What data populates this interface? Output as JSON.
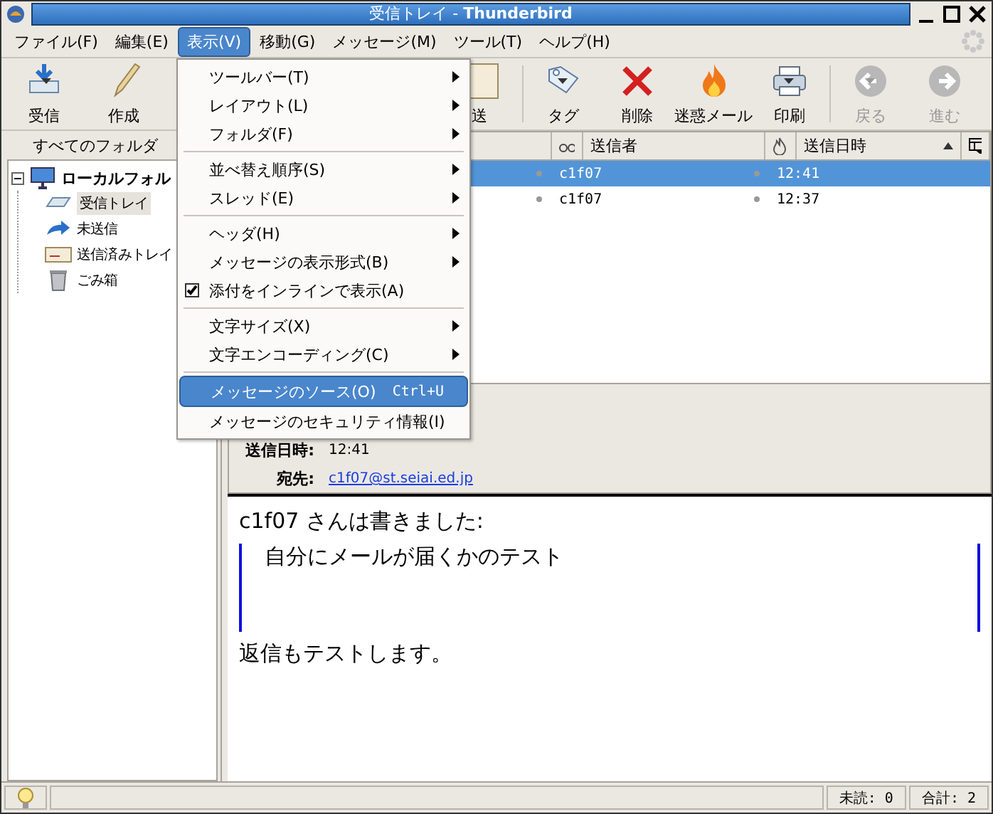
{
  "window": {
    "title": "受信トレイ - ",
    "title_bold": "Thunderbird"
  },
  "menubar": [
    {
      "label": "ファイル(F)",
      "selected": false
    },
    {
      "label": "編集(E)",
      "selected": false
    },
    {
      "label": "表示(V)",
      "selected": true
    },
    {
      "label": "移動(G)",
      "selected": false
    },
    {
      "label": "メッセージ(M)",
      "selected": false
    },
    {
      "label": "ツール(T)",
      "selected": false
    },
    {
      "label": "ヘルプ(H)",
      "selected": false
    }
  ],
  "toolbar": [
    {
      "label": "受信",
      "dropdown": true,
      "disabled": false
    },
    {
      "label": "作成",
      "dropdown": false,
      "disabled": false
    },
    {
      "label": "送",
      "dropdown": false,
      "disabled": false
    },
    {
      "label": "タグ",
      "dropdown": true,
      "disabled": false
    },
    {
      "label": "削除",
      "dropdown": false,
      "disabled": false
    },
    {
      "label": "迷惑メール",
      "dropdown": false,
      "disabled": false
    },
    {
      "label": "印刷",
      "dropdown": true,
      "disabled": false
    },
    {
      "label": "戻る",
      "dropdown": true,
      "disabled": true
    },
    {
      "label": "進む",
      "dropdown": false,
      "disabled": true
    }
  ],
  "sidebar": {
    "header": "すべてのフォルダ",
    "folders": [
      {
        "label": "ローカルフォル",
        "expanded": true,
        "selected": false,
        "children": [
          {
            "label": "受信トレイ",
            "selected": true
          },
          {
            "label": "未送信",
            "selected": false
          },
          {
            "label": "送信済みトレイ",
            "selected": false
          },
          {
            "label": "ごみ箱",
            "selected": false
          }
        ]
      }
    ]
  },
  "thread_list": {
    "columns": [
      {
        "kind": "read"
      },
      {
        "kind": "text",
        "label": "送信者"
      },
      {
        "kind": "junk"
      },
      {
        "kind": "text",
        "label": "送信日時",
        "sorted": true
      },
      {
        "kind": "picker"
      }
    ],
    "rows": [
      {
        "sender": "c1f07",
        "date": "12:41",
        "selected": true
      },
      {
        "sender": "c1f07",
        "date": "12:37",
        "selected": false
      }
    ]
  },
  "message_header": [
    {
      "label": "送信日時:",
      "value": "12:41",
      "link": false
    },
    {
      "label": "宛先:",
      "value": "c1f07@st.seiai.ed.jp",
      "link": true
    }
  ],
  "message_body": {
    "attribution": "c1f07 さんは書きました:",
    "quote": "自分にメールが届くかのテスト",
    "reply": "返信もテストします。"
  },
  "menu": [
    {
      "kind": "submenu",
      "label": "ツールバー(T)"
    },
    {
      "kind": "submenu",
      "label": "レイアウト(L)"
    },
    {
      "kind": "submenu",
      "label": "フォルダ(F)"
    },
    {
      "kind": "separator"
    },
    {
      "kind": "submenu",
      "label": "並べ替え順序(S)"
    },
    {
      "kind": "submenu",
      "label": "スレッド(E)"
    },
    {
      "kind": "separator"
    },
    {
      "kind": "submenu",
      "label": "ヘッダ(H)"
    },
    {
      "kind": "submenu",
      "label": "メッセージの表示形式(B)"
    },
    {
      "kind": "check",
      "label": "添付をインラインで表示(A)",
      "checked": true
    },
    {
      "kind": "separator"
    },
    {
      "kind": "submenu",
      "label": "文字サイズ(X)"
    },
    {
      "kind": "submenu",
      "label": "文字エンコーディング(C)"
    },
    {
      "kind": "separator"
    },
    {
      "kind": "command",
      "label": "メッセージのソース(O)",
      "shortcut": "Ctrl+U",
      "selected": true
    },
    {
      "kind": "command",
      "label": "メッセージのセキュリティ情報(I)",
      "selected": false
    }
  ],
  "status_bar": {
    "unread": "未読: 0",
    "total": "合計: 2"
  }
}
